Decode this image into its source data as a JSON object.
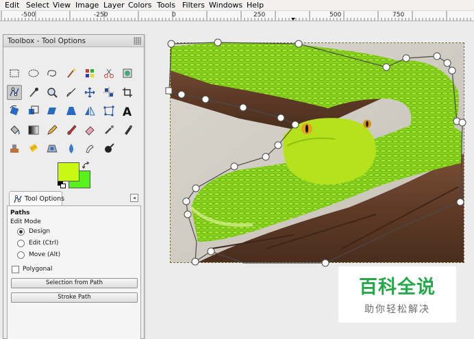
{
  "menubar": {
    "items": [
      "Edit",
      "Select",
      "View",
      "Image",
      "Layer",
      "Colors",
      "Tools",
      "Filters",
      "Windows",
      "Help"
    ]
  },
  "ruler": {
    "labels": [
      "-500",
      "-250",
      "0",
      "250",
      "500",
      "750"
    ]
  },
  "toolbox": {
    "title": "Toolbox - Tool Options",
    "tools": [
      [
        "rect-select-icon",
        "ellipse-select-icon",
        "free-select-icon",
        "fuzzy-select-icon",
        "select-by-color-icon",
        "scissors-icon",
        "foreground-select-icon"
      ],
      [
        "paths-icon",
        "color-picker-icon",
        "zoom-icon",
        "measure-icon",
        "move-icon",
        "align-icon",
        "crop-icon"
      ],
      [
        "rotate-icon",
        "scale-icon",
        "shear-icon",
        "perspective-icon",
        "flip-icon",
        "cage-icon",
        "text-icon"
      ],
      [
        "bucket-fill-icon",
        "blend-icon",
        "pencil-icon",
        "paintbrush-icon",
        "eraser-icon",
        "airbrush-icon",
        "ink-icon"
      ],
      [
        "clone-icon",
        "heal-icon",
        "perspective-clone-icon",
        "blur-icon",
        "smudge-icon",
        "dodge-burn-icon"
      ]
    ],
    "active_tool": "paths-icon",
    "foreground_color": "#c8f814",
    "background_color": "#5af01c"
  },
  "tool_options": {
    "tab_label": "Tool Options",
    "section_title": "Paths",
    "edit_mode_label": "Edit Mode",
    "modes": [
      {
        "label": "Design",
        "selected": true
      },
      {
        "label": "Edit (Ctrl)",
        "selected": false
      },
      {
        "label": "Move (Alt)",
        "selected": false
      }
    ],
    "polygonal_label": "Polygonal",
    "polygonal_checked": false,
    "selection_from_path_label": "Selection from Path",
    "stroke_path_label": "Stroke Path"
  },
  "watermark": {
    "title": "百科全说",
    "subtitle": "助你轻松解决"
  }
}
